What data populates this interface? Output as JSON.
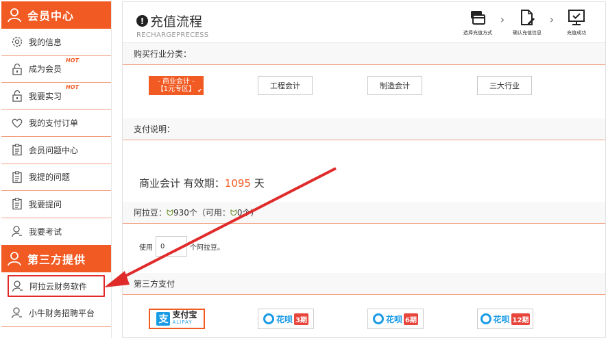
{
  "sidebar": {
    "member_title": "会员中心",
    "items": [
      {
        "label": "我的信息",
        "icon": "gear-icon"
      },
      {
        "label": "成为会员",
        "icon": "lock-icon",
        "hot": "HOT"
      },
      {
        "label": "我要实习",
        "icon": "lock-icon",
        "hot": "HOT"
      },
      {
        "label": "我的支付订单",
        "icon": "heart-icon"
      },
      {
        "label": "会员问题中心",
        "icon": "clipboard-icon"
      },
      {
        "label": "我提的问题",
        "icon": "clipboard-icon"
      },
      {
        "label": "我要提问",
        "icon": "clipboard-icon"
      },
      {
        "label": "我要考试",
        "icon": "user-icon"
      }
    ],
    "third_title": "第三方提供",
    "third_items": [
      {
        "label": "阿拉云财务软件",
        "icon": "user-icon"
      },
      {
        "label": "小牛财务招聘平台",
        "icon": "user-icon"
      }
    ]
  },
  "header": {
    "title": "充值流程",
    "subtitle": "RECHARGEPRECESS",
    "steps": [
      {
        "label": "选择充值方式",
        "icon": "card-select-icon"
      },
      {
        "label": "确认充值信息",
        "icon": "document-edit-icon"
      },
      {
        "label": "充值成功",
        "icon": "monitor-check-icon"
      }
    ]
  },
  "industry": {
    "heading": "购买行业分类：",
    "options": [
      {
        "line1": "- 商业会计 -",
        "line2": "【1元专区】",
        "selected": true
      },
      {
        "label": "工程会计"
      },
      {
        "label": "制造会计"
      },
      {
        "label": "三大行业"
      }
    ]
  },
  "payment_desc": {
    "heading": "支付说明：",
    "validity_prefix": "商业会计 有效期：",
    "validity_days": "1095",
    "validity_unit": " 天"
  },
  "beans": {
    "heading": "阿拉豆：",
    "heading_detail": "930个（可用：",
    "heading_detail2": "0个）",
    "use_label": "使用",
    "input_value": "0",
    "unit_label": "个阿拉豆。"
  },
  "third_pay": {
    "heading": "第三方支付",
    "alipay": {
      "name": "支付宝",
      "sub": "ALIPAY"
    },
    "huabei": [
      {
        "name": "花呗",
        "badge": "3期"
      },
      {
        "name": "花呗",
        "badge": "6期"
      },
      {
        "name": "花呗",
        "badge": "12期"
      }
    ]
  },
  "colors": {
    "accent": "#f15a22",
    "highlight_box": "#e02b2b",
    "alipay_blue": "#1a9be6"
  }
}
